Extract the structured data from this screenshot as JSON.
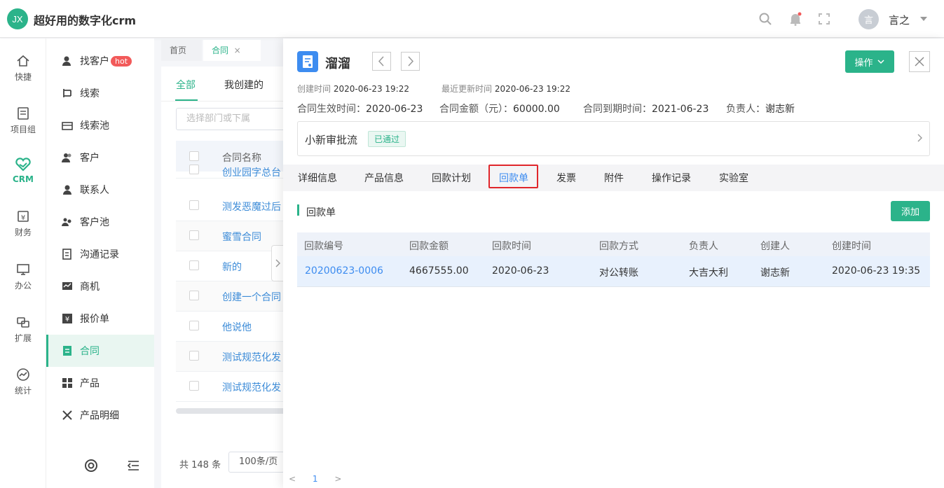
{
  "app": {
    "logo_text": "JX",
    "title": "超好用的数字化crm"
  },
  "user": {
    "avatar_text": "言",
    "name": "言之"
  },
  "rail": [
    {
      "label": "快捷",
      "icon": "home-icon"
    },
    {
      "label": "项目组",
      "icon": "document-icon"
    },
    {
      "label": "CRM",
      "icon": "crm-icon"
    },
    {
      "label": "财务",
      "icon": "finance-icon"
    },
    {
      "label": "办公",
      "icon": "desktop-icon"
    },
    {
      "label": "扩展",
      "icon": "extend-icon"
    },
    {
      "label": "统计",
      "icon": "stats-icon"
    }
  ],
  "menu": [
    {
      "label": "找客户",
      "badge": "hot",
      "icon": "find-customer-icon"
    },
    {
      "label": "线索",
      "icon": "lead-icon"
    },
    {
      "label": "线索池",
      "icon": "lead-pool-icon"
    },
    {
      "label": "客户",
      "icon": "customer-icon"
    },
    {
      "label": "联系人",
      "icon": "contact-icon"
    },
    {
      "label": "客户池",
      "icon": "customer-pool-icon"
    },
    {
      "label": "沟通记录",
      "icon": "communication-icon"
    },
    {
      "label": "商机",
      "icon": "opportunity-icon"
    },
    {
      "label": "报价单",
      "icon": "quote-icon"
    },
    {
      "label": "合同",
      "icon": "contract-icon"
    },
    {
      "label": "产品",
      "icon": "product-icon"
    },
    {
      "label": "产品明细",
      "icon": "product-detail-icon"
    }
  ],
  "page_tabs": [
    {
      "label": "首页"
    },
    {
      "label": "合同",
      "close": "×"
    }
  ],
  "list": {
    "tabs": [
      "全部",
      "我创建的"
    ],
    "filter_placeholder": "选择部门或下属",
    "header": "合同名称",
    "rows": [
      "创业园字总台",
      "测发恶魔过后",
      "蜜雪合同",
      "新的",
      "创建一个合同",
      "他说他",
      "测试规范化发",
      "测试规范化发"
    ],
    "total": "共 148 条",
    "page_size": "100条/页"
  },
  "drawer": {
    "title": "溜溜",
    "op_button": "操作",
    "meta": {
      "created_label": "创建时间",
      "created": "2020-06-23 19:22",
      "updated_label": "最近更新时间",
      "updated": "2020-06-23 19:22"
    },
    "info": {
      "effective_label": "合同生效时间：",
      "effective": "2020-06-23",
      "amount_label": "合同金额（元）：",
      "amount": "60000.00",
      "expire_label": "合同到期时间：",
      "expire": "2021-06-23",
      "owner_label": "负责人：",
      "owner": "谢志新"
    },
    "flow": {
      "name": "小新审批流",
      "status": "已通过"
    },
    "tabs": [
      "详细信息",
      "产品信息",
      "回款计划",
      "回款单",
      "发票",
      "附件",
      "操作记录",
      "实验室"
    ],
    "active_tab": "回款单",
    "section_title": "回款单",
    "add_button": "添加",
    "table": {
      "columns": [
        "回款编号",
        "回款金额",
        "回款时间",
        "回款方式",
        "负责人",
        "创建人",
        "创建时间"
      ],
      "rows": [
        [
          "20200623-0006",
          "4667555.00",
          "2020-06-23",
          "对公转账",
          "大吉大利",
          "谢志新",
          "2020-06-23 19:35"
        ]
      ]
    },
    "pager": {
      "prev": "<",
      "page": "1",
      "next": ">"
    }
  },
  "colors": {
    "accent": "#2bb38a",
    "link": "#3d8cf0",
    "highlight_border": "#e0262b"
  }
}
